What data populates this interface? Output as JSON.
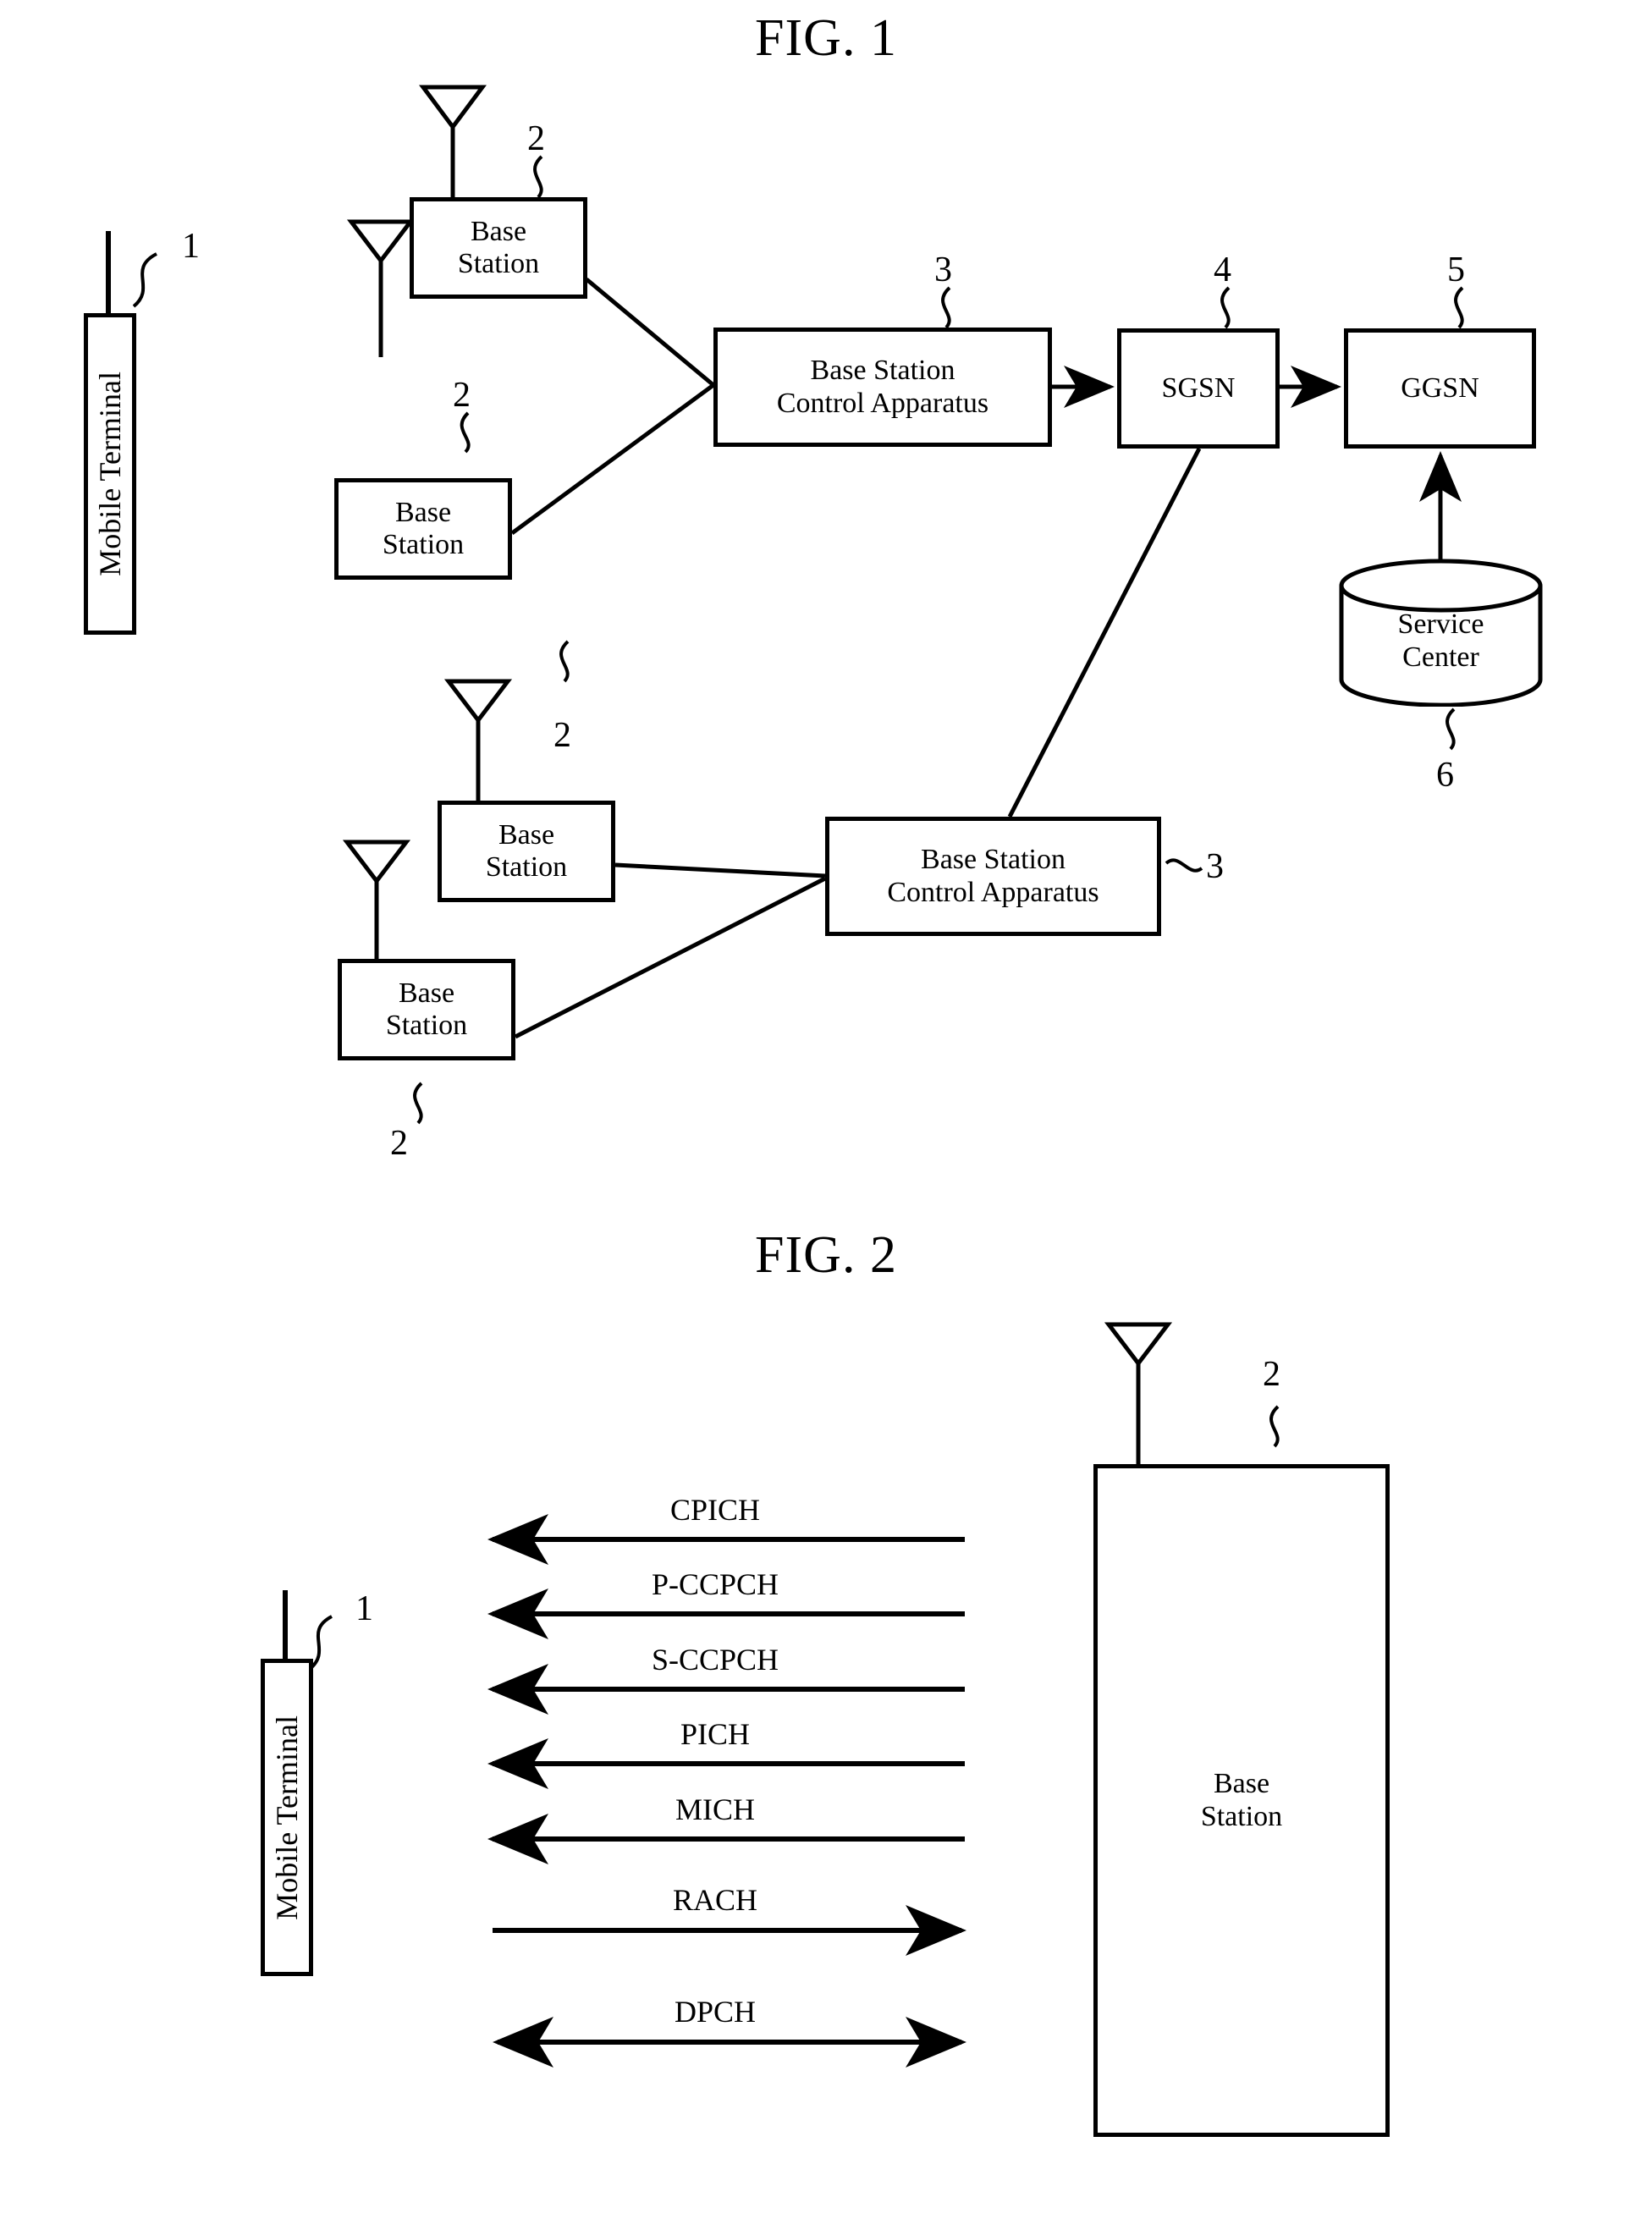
{
  "figures": [
    {
      "title": "FIG. 1",
      "nodes": {
        "mobile_terminal": "Mobile Terminal",
        "base_station": "Base Station",
        "base_station_line1": "Base",
        "base_station_line2": "Station",
        "bsc_line1": "Base Station",
        "bsc_line2": "Control Apparatus",
        "sgsn": "SGSN",
        "ggsn": "GGSN",
        "service_center_line1": "Service",
        "service_center_line2": "Center"
      },
      "reference_numerals": {
        "mobile_terminal": "1",
        "base_station": "2",
        "base_station_control_apparatus": "3",
        "sgsn": "4",
        "ggsn": "5",
        "service_center": "6"
      }
    },
    {
      "title": "FIG. 2",
      "nodes": {
        "mobile_terminal": "Mobile Terminal",
        "base_station_line1": "Base",
        "base_station_line2": "Station"
      },
      "reference_numerals": {
        "mobile_terminal": "1",
        "base_station": "2"
      },
      "channels": [
        {
          "name": "CPICH",
          "direction": "downlink"
        },
        {
          "name": "P-CCPCH",
          "direction": "downlink"
        },
        {
          "name": "S-CCPCH",
          "direction": "downlink"
        },
        {
          "name": "PICH",
          "direction": "downlink"
        },
        {
          "name": "MICH",
          "direction": "downlink"
        },
        {
          "name": "RACH",
          "direction": "uplink"
        },
        {
          "name": "DPCH",
          "direction": "bidirectional"
        }
      ]
    }
  ],
  "colors": {
    "ink": "#000000",
    "paper": "#ffffff"
  }
}
